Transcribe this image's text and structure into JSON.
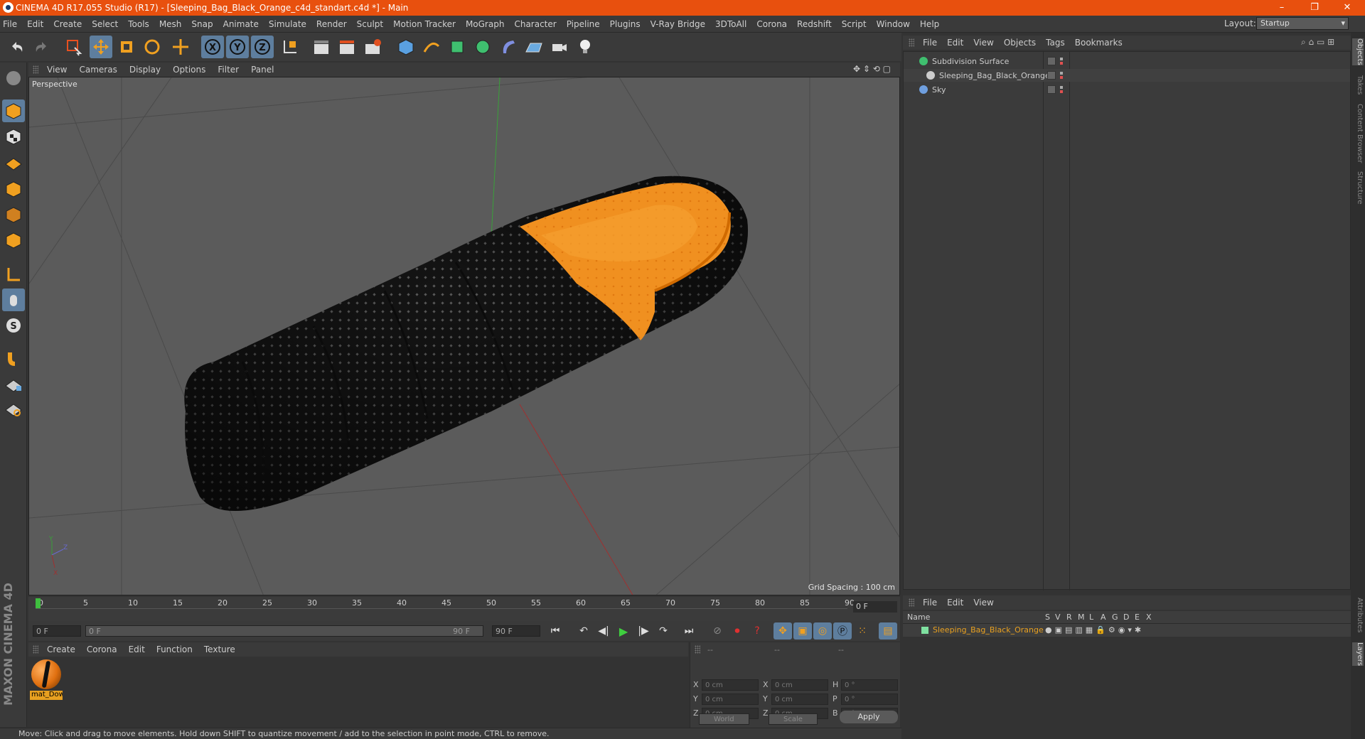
{
  "window": {
    "title": "CINEMA 4D R17.055 Studio (R17) - [Sleeping_Bag_Black_Orange_c4d_standart.c4d *] - Main",
    "minimize": "–",
    "restore": "❐",
    "close": "✕"
  },
  "menubar": {
    "items": [
      "File",
      "Edit",
      "Create",
      "Select",
      "Tools",
      "Mesh",
      "Snap",
      "Animate",
      "Simulate",
      "Render",
      "Sculpt",
      "Motion Tracker",
      "MoGraph",
      "Character",
      "Pipeline",
      "Plugins",
      "V-Ray Bridge",
      "3DToAll",
      "Corona",
      "Redshift",
      "Script",
      "Window",
      "Help"
    ],
    "layout_label": "Layout:",
    "layout_value": "Startup"
  },
  "viewport": {
    "menu": [
      "View",
      "Cameras",
      "Display",
      "Options",
      "Filter",
      "Panel"
    ],
    "label": "Perspective",
    "grid_spacing": "Grid Spacing : 100 cm"
  },
  "timeline": {
    "ticks": [
      "0",
      "5",
      "10",
      "15",
      "20",
      "25",
      "30",
      "35",
      "40",
      "45",
      "50",
      "55",
      "60",
      "65",
      "70",
      "75",
      "80",
      "85",
      "90"
    ],
    "frame": "0 F",
    "start": "0 F",
    "range_start": "0 F",
    "range_end": "90 F",
    "end": "90 F"
  },
  "material_manager": {
    "menu": [
      "Create",
      "Corona",
      "Edit",
      "Function",
      "Texture"
    ],
    "material_name": "mat_Dow"
  },
  "coordinates": {
    "headers": [
      "--",
      "--",
      "--"
    ],
    "rows": [
      {
        "l1": "X",
        "v1": "0 cm",
        "l2": "X",
        "v2": "0 cm",
        "l3": "H",
        "v3": "0 °"
      },
      {
        "l1": "Y",
        "v1": "0 cm",
        "l2": "Y",
        "v2": "0 cm",
        "l3": "P",
        "v3": "0 °"
      },
      {
        "l1": "Z",
        "v1": "0 cm",
        "l2": "Z",
        "v2": "0 cm",
        "l3": "B",
        "v3": "0 °"
      }
    ],
    "space": "World",
    "mode": "Scale",
    "apply": "Apply"
  },
  "status": "Move: Click and drag to move elements. Hold down SHIFT to quantize movement / add to the selection in point mode, CTRL to remove.",
  "object_manager": {
    "menu": [
      "File",
      "Edit",
      "View",
      "Objects",
      "Tags",
      "Bookmarks"
    ],
    "objects": [
      {
        "name": "Subdivision Surface",
        "color": "#3fbf6f"
      },
      {
        "name": "Sleeping_Bag_Black_Orange",
        "color": "#cccccc"
      },
      {
        "name": "Sky",
        "color": "#6f9fdf"
      }
    ]
  },
  "layer_manager": {
    "menu": [
      "File",
      "Edit",
      "View"
    ],
    "columns": [
      "Name",
      "S",
      "V",
      "R",
      "M",
      "L",
      "A",
      "G",
      "D",
      "E",
      "X"
    ],
    "layer_name": "Sleeping_Bag_Black_Orange"
  },
  "side_tabs": [
    "Objects",
    "Takes",
    "Content Browser",
    "Structure",
    "Attributes",
    "Layers"
  ],
  "brand": "MAXON CINEMA 4D"
}
